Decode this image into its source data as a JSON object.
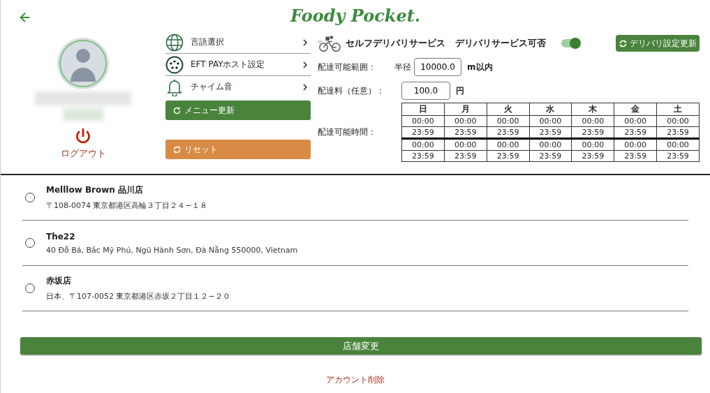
{
  "header": {
    "logo": "Foody Pocket."
  },
  "profile": {
    "logout": "ログアウト"
  },
  "menu": [
    {
      "label": "言語選択",
      "kind": "globe"
    },
    {
      "label": "EFT PAYホスト設定",
      "kind": "plug"
    },
    {
      "label": "チャイム音",
      "kind": "bell"
    }
  ],
  "menu_update": "メニュー更新",
  "reset": "リセット",
  "delivery": {
    "title": "セルフデリバリサービス",
    "toggle_label": "デリバリサービス可否",
    "on": true,
    "update_button": "デリバリ設定更新",
    "range_label": "配達可能範囲：",
    "radius_label": "半径",
    "radius": "10000.0",
    "radius_unit": "m以内",
    "fee_label": "配達料（任意）：",
    "fee": "100.0",
    "fee_unit": "円",
    "hours_label": "配達可能時間：",
    "days": [
      "日",
      "月",
      "火",
      "水",
      "木",
      "金",
      "土"
    ],
    "hours": [
      [
        "00:00",
        "00:00",
        "00:00",
        "00:00",
        "00:00",
        "00:00",
        "00:00"
      ],
      [
        "23:59",
        "23:59",
        "23:59",
        "23:59",
        "23:59",
        "23:59",
        "23:59"
      ],
      [
        "00:00",
        "00:00",
        "00:00",
        "00:00",
        "00:00",
        "00:00",
        "00:00"
      ],
      [
        "23:59",
        "23:59",
        "23:59",
        "23:59",
        "23:59",
        "23:59",
        "23:59"
      ]
    ]
  },
  "stores": [
    {
      "name": "Melllow Brown 品川店",
      "address": "〒108-0074 東京都港区高輪３丁目２４−１８",
      "selected": false
    },
    {
      "name": "The22",
      "address": "40 Đỗ Bá, Bắc Mỹ Phú, Ngũ Hành Sơn, Đà Nẵng 550000, Vietnam",
      "selected": false
    },
    {
      "name": "赤坂店",
      "address": "日本、〒107-0052 東京都港区赤坂２丁目１２−２０",
      "selected": false
    }
  ],
  "change_store": "店舗変更",
  "delete_account": "アカウント削除"
}
